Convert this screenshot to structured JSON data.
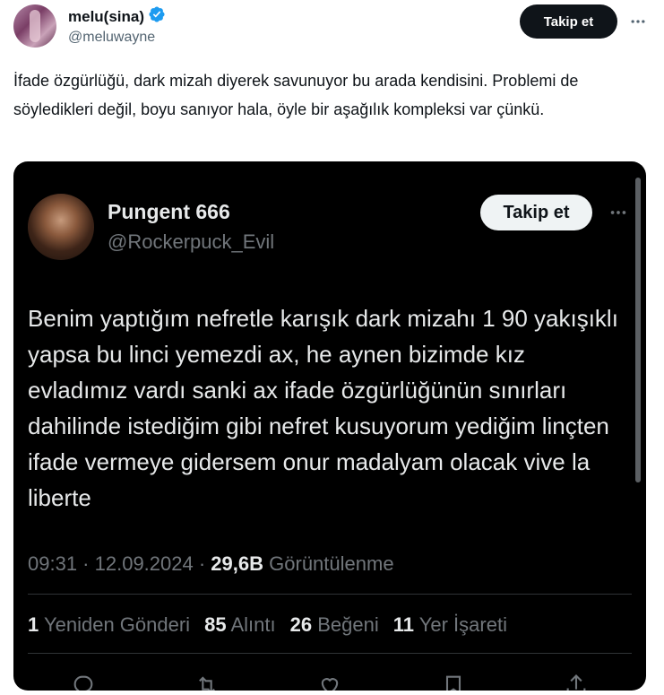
{
  "post": {
    "author_name": "melu(sina)",
    "author_handle": "@meluwayne",
    "follow_label": "Takip et",
    "text": "İfade özgürlüğü, dark mizah diyerek savunuyor bu arada kendisini. Problemi de söyledikleri değil, boyu sanıyor hala, öyle bir aşağılık kompleksi var çünkü."
  },
  "quoted": {
    "author_name": "Pungent 666",
    "author_handle": "@Rockerpuck_Evil",
    "follow_label": "Takip et",
    "text": "Benim yaptığım nefretle karışık dark mizahı 1 90 yakışıklı yapsa bu linci yemezdi ax, he aynen bizimde kız evladımız vardı sanki ax ifade özgürlüğünün sınırları dahilinde istediğim gibi nefret kusuyorum yediğim linçten ifade vermeye gidersem onur madalyam olacak  vive la liberte",
    "time": "09:31",
    "date": "12.09.2024",
    "views_count": "29,6B",
    "views_label": "Görüntülenme",
    "stats": {
      "reposts_count": "1",
      "reposts_label": "Yeniden Gönderi",
      "quotes_count": "85",
      "quotes_label": "Alıntı",
      "likes_count": "26",
      "likes_label": "Beğeni",
      "bookmarks_count": "11",
      "bookmarks_label": "Yer İşareti"
    }
  },
  "colors": {
    "verified": "#1d9bf0",
    "dark_bg": "#000000",
    "muted": "#71767b"
  },
  "icons": [
    "verified-badge-icon",
    "more-icon",
    "reply-icon",
    "repost-icon",
    "like-icon",
    "bookmark-icon",
    "share-icon"
  ]
}
